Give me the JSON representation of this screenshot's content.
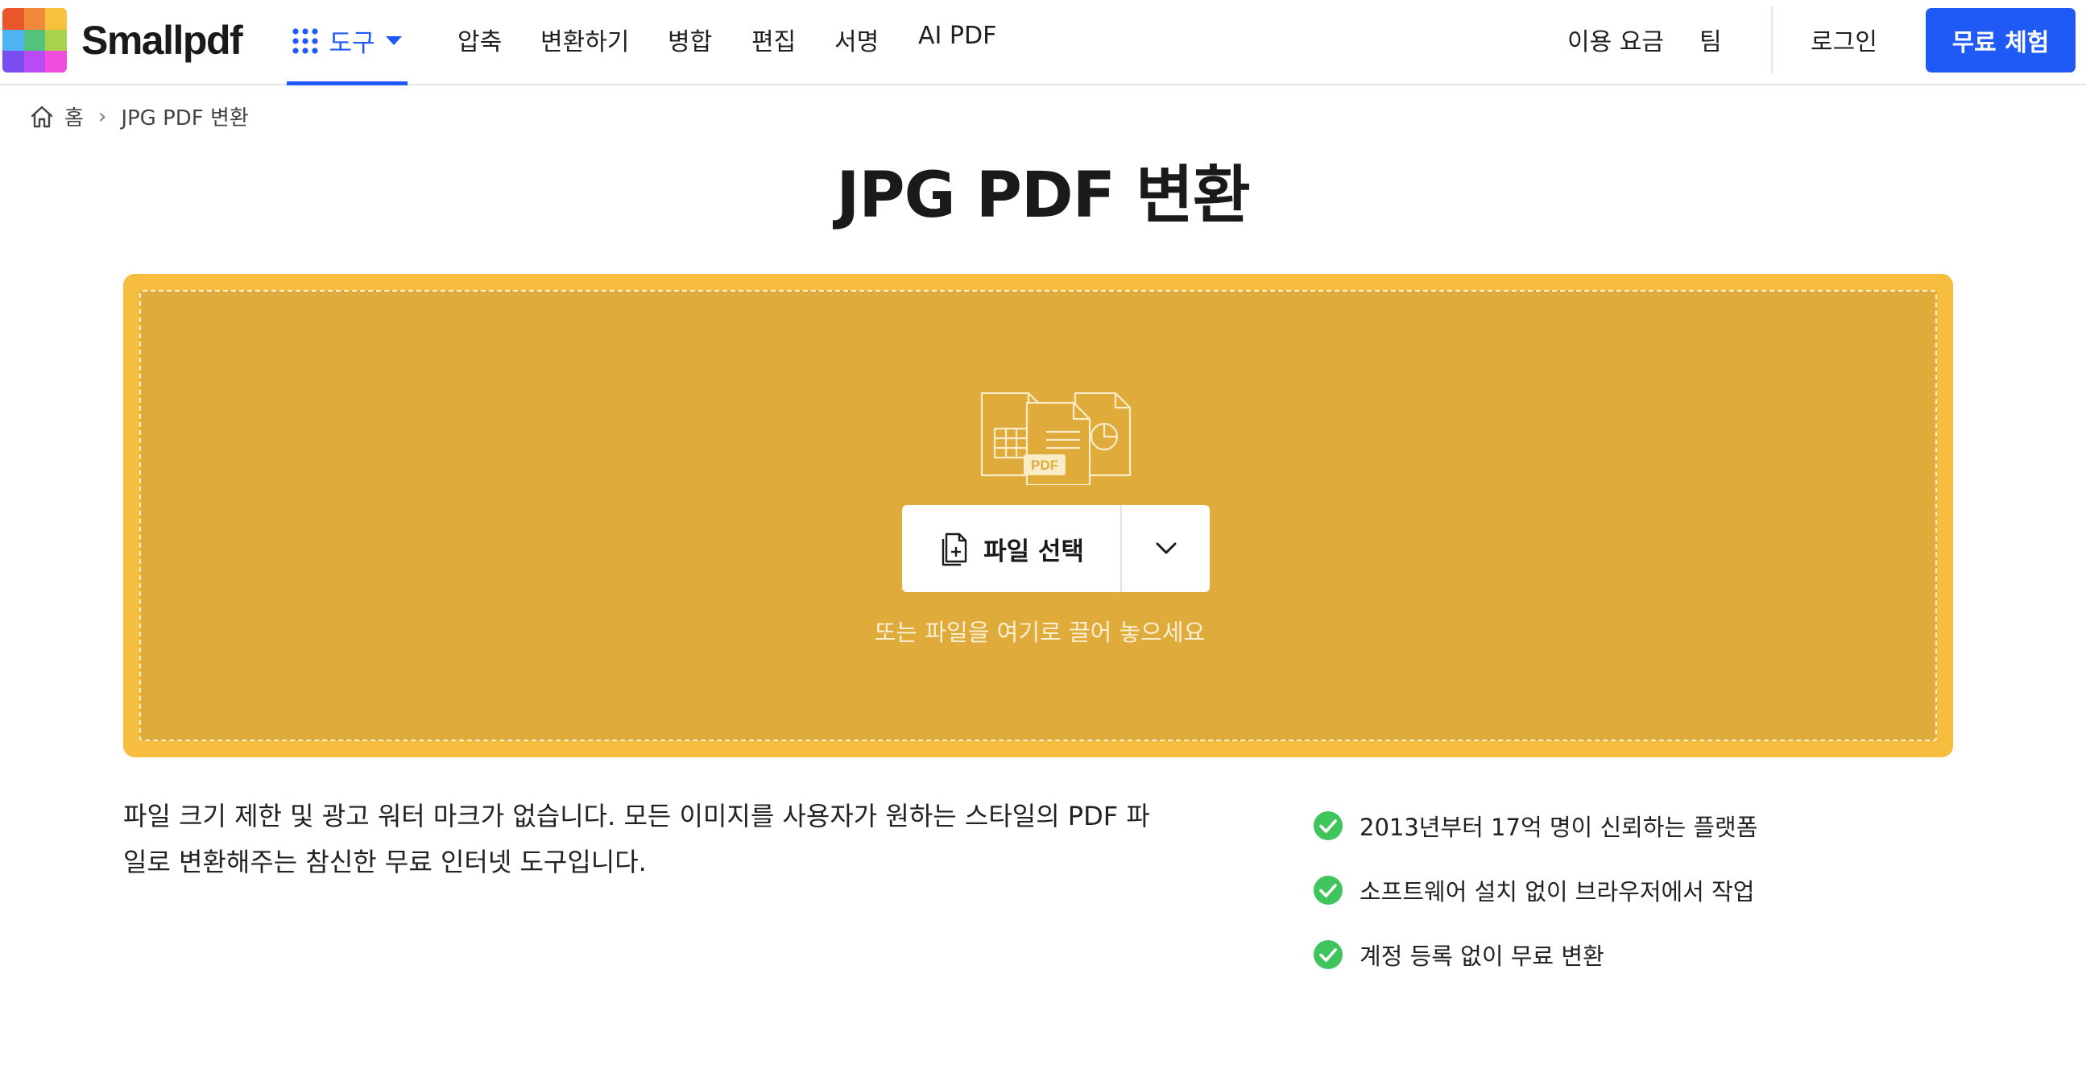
{
  "brand": {
    "name": "Smallpdf",
    "logo_colors": [
      "#e8562a",
      "#f2893a",
      "#f7c23b",
      "#4fb3f3",
      "#53c27a",
      "#a7d34b",
      "#7a4df0",
      "#b84cf2",
      "#f04ce0"
    ]
  },
  "header": {
    "tools_label": "도구",
    "nav": [
      "압축",
      "변환하기",
      "병합",
      "편집",
      "서명",
      "AI PDF"
    ],
    "pricing": "이용 요금",
    "team": "팀",
    "login": "로그인",
    "trial": "무료 체험",
    "accent": "#1f5af6"
  },
  "breadcrumb": {
    "home": "홈",
    "current": "JPG PDF 변환"
  },
  "page_title": "JPG PDF 변환",
  "dropzone": {
    "illustration_label": "PDF",
    "select_label": "파일 선택",
    "hint": "또는 파일을 여기로 끌어 놓으세요",
    "color_outer": "#f7bd3e",
    "color_inner": "#dfab3a"
  },
  "description": "파일 크기 제한 및 광고 워터 마크가 없습니다. 모든 이미지를 사용자가 원하는 스타일의 PDF 파일로 변환해주는 참신한 무료 인터넷 도구입니다.",
  "features": [
    "2013년부터 17억 명이 신뢰하는 플랫폼",
    "소프트웨어 설치 없이 브라우저에서 작업",
    "계정 등록 없이 무료 변환"
  ],
  "check_color": "#3fc55b"
}
